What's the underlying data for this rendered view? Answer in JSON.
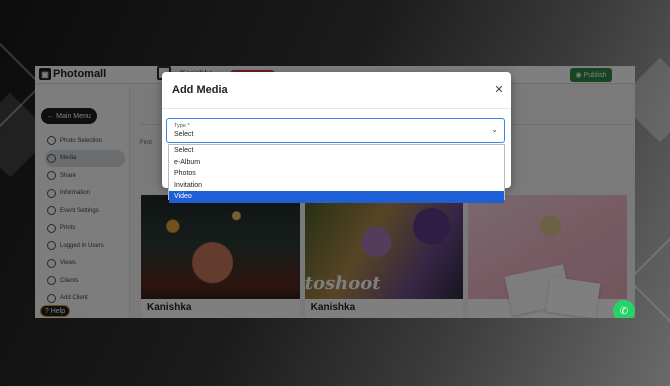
{
  "app": {
    "logo": "Photomall",
    "title": "Kanishka",
    "publish_label": "Publish"
  },
  "sidebar": {
    "main_menu_label": "Main Menu",
    "items": [
      {
        "label": "Photo Selection",
        "icon": "photo-selection-icon"
      },
      {
        "label": "Media",
        "icon": "media-icon",
        "active": true
      },
      {
        "label": "Share",
        "icon": "share-icon"
      },
      {
        "label": "Information",
        "icon": "info-icon"
      },
      {
        "label": "Event Settings",
        "icon": "gear-icon"
      },
      {
        "label": "Prints",
        "icon": "print-icon"
      },
      {
        "label": "Logged in Users",
        "icon": "users-icon"
      },
      {
        "label": "Views",
        "icon": "eye-icon"
      },
      {
        "label": "Clients",
        "icon": "client-icon"
      },
      {
        "label": "Add Client",
        "icon": "add-client-icon"
      }
    ],
    "help_label": "Help"
  },
  "content": {
    "find_label": "Find",
    "gallery": [
      {
        "caption": "Kanishka"
      },
      {
        "caption": "Kanishka",
        "overlay_text": "toshoot"
      },
      {
        "caption": ""
      }
    ]
  },
  "modal": {
    "title": "Add Media",
    "close_icon": "close-icon",
    "field": {
      "legend": "Type *",
      "value": "Select"
    },
    "options": [
      "Select",
      "e-Album",
      "Photos",
      "Invitation",
      "Video"
    ],
    "highlighted_option": "Video"
  },
  "colors": {
    "publish": "#2f8a45",
    "highlight": "#1f5fd6",
    "whatsapp": "#25d366",
    "focus_border": "#3b82f6"
  }
}
